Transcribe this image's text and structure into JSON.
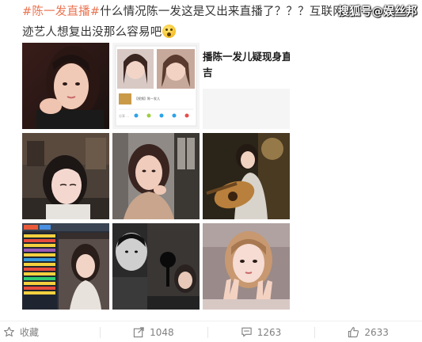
{
  "post": {
    "topic": "#陈一发直播#",
    "text_line1": "什么情况陈一发这是又出来直播了？？？互联网",
    "text_line2": "迹艺人想复出没那么容易吧",
    "emoji": "吃惊",
    "watermark": "搜狐号@娱丝邦"
  },
  "screenshot_card": {
    "caption": "【视频】陈一发儿",
    "count": "分享 ..."
  },
  "headline_card": {
    "line1": "播陈一发儿疑现身直",
    "line2": "吉"
  },
  "actions": {
    "favorite_label": "收藏",
    "repost_count": "1048",
    "comment_count": "1263",
    "like_count": "2633"
  },
  "colors": {
    "topic": "#eb7350",
    "text": "#333333",
    "meta": "#808080"
  }
}
